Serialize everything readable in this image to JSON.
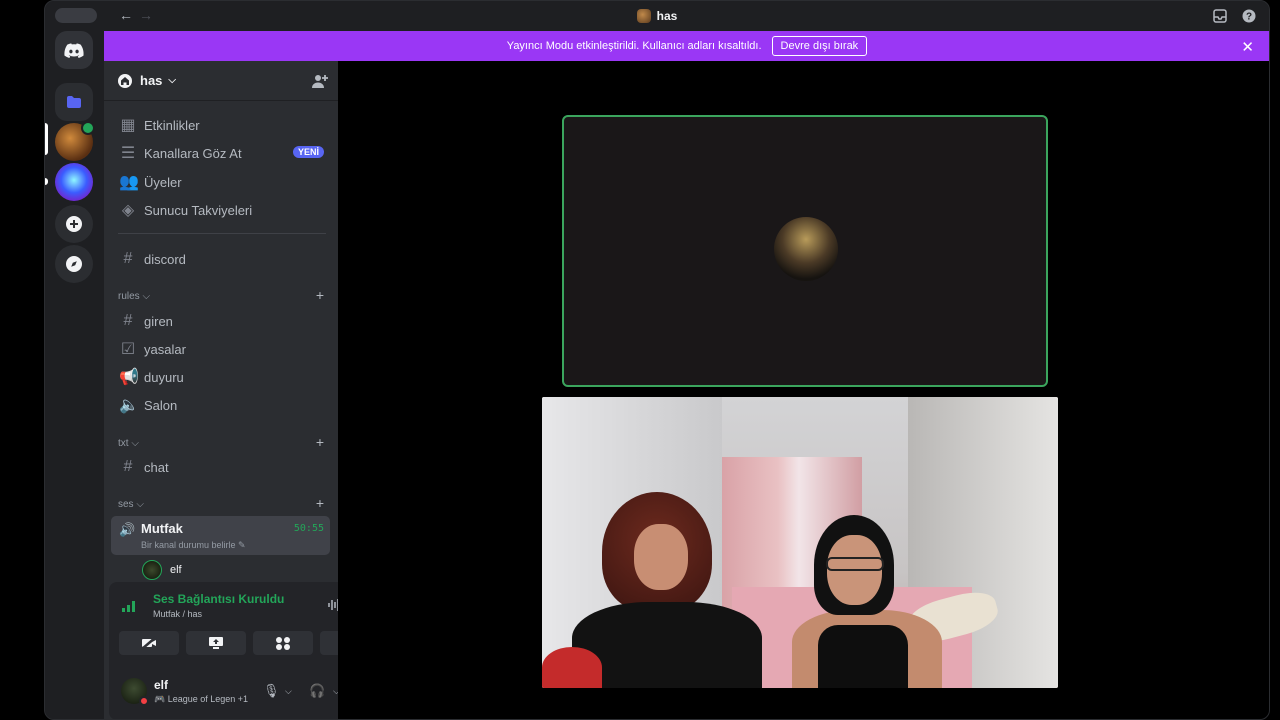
{
  "titlebar": {
    "title": "has",
    "back": "←",
    "forward": "→"
  },
  "banner": {
    "message": "Yayıncı Modu etkinleştirildi. Kullanıcı adları kısaltıldı.",
    "button_label": "Devre dışı bırak",
    "close": "✕"
  },
  "server": {
    "name": "has"
  },
  "sidebar": {
    "top_items": [
      {
        "label": "Etkinlikler",
        "icon": "calendar-icon"
      },
      {
        "label": "Kanallara Göz At",
        "icon": "browse-channels-icon",
        "badge": "YENİ"
      },
      {
        "label": "Üyeler",
        "icon": "members-icon"
      },
      {
        "label": "Sunucu Takviyeleri",
        "icon": "boost-icon"
      }
    ],
    "standalone_channel": {
      "label": "discord",
      "icon": "hash-icon"
    },
    "categories": [
      {
        "name": "rules",
        "channels": [
          {
            "label": "giren",
            "icon": "hash-icon"
          },
          {
            "label": "yasalar",
            "icon": "rules-icon"
          },
          {
            "label": "duyuru",
            "icon": "announcement-icon"
          },
          {
            "label": "Salon",
            "icon": "speaker-icon"
          }
        ]
      },
      {
        "name": "txt",
        "channels": [
          {
            "label": "chat",
            "icon": "hash-icon"
          }
        ]
      },
      {
        "name": "ses",
        "channels": []
      }
    ],
    "active_voice": {
      "name": "Mutfak",
      "status": "Bir kanal durumu belirle",
      "time": "50:55",
      "user": "elf"
    }
  },
  "voice_panel": {
    "title": "Ses Bağlantısı Kuruldu",
    "subtitle": "Mutfak / has"
  },
  "user": {
    "name": "elf",
    "status": "League of Legen +1"
  },
  "colors": {
    "accent": "#5865f2",
    "banner": "#9a37f5",
    "online_green": "#23a559",
    "dnd_red": "#f23f43"
  }
}
